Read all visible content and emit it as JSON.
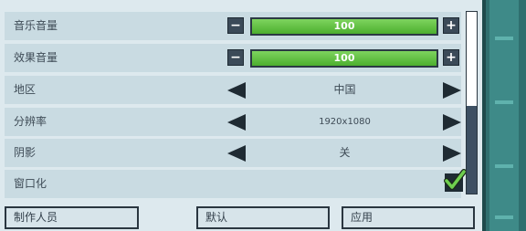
{
  "settings": {
    "music_volume": {
      "label": "音乐音量",
      "value": "100",
      "level": 1.0
    },
    "effects_volume": {
      "label": "效果音量",
      "value": "100",
      "level": 1.0
    },
    "region": {
      "label": "地区",
      "value": "中国"
    },
    "resolution": {
      "label": "分辨率",
      "value": "1920x1080"
    },
    "shadows": {
      "label": "阴影",
      "value": "关"
    },
    "windowed": {
      "label": "窗口化",
      "checked": true
    }
  },
  "icons": {
    "minus": "−",
    "plus": "+",
    "arrow_left": "arrow-left-icon",
    "arrow_right": "arrow-right-icon",
    "check": "check-icon"
  },
  "scrollbar": {
    "position": 0.52,
    "thumb_size": 0.48
  },
  "buttons": {
    "credits": "制作人员",
    "default": "默认",
    "apply": "应用"
  },
  "colors": {
    "bar_fill": "#5cbc3a",
    "row_bg": "#c9dbe2",
    "dark": "#1f2b33"
  }
}
